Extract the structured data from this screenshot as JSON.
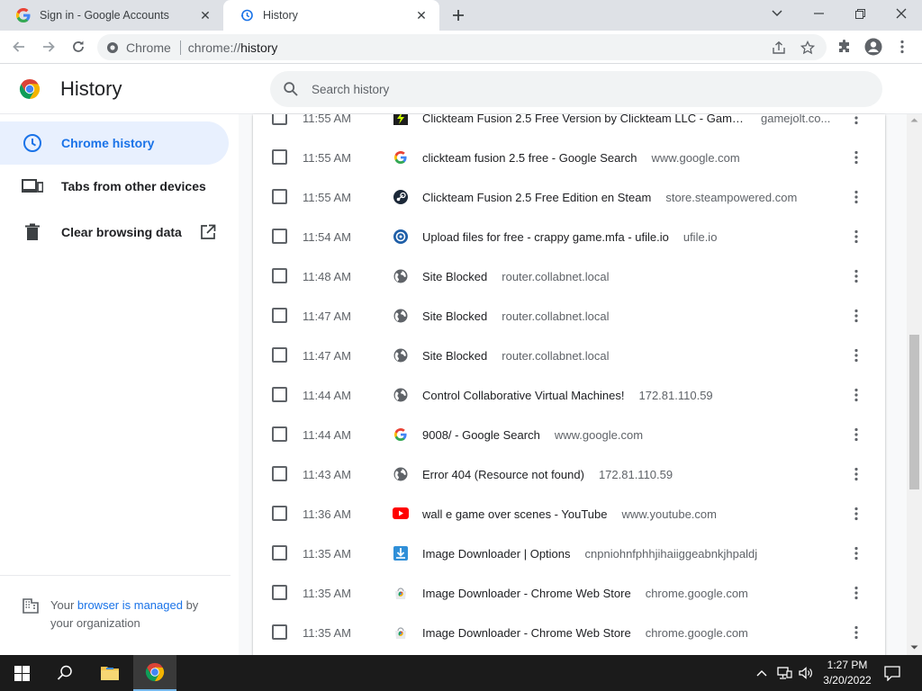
{
  "tabs": [
    {
      "title": "Sign in - Google Accounts",
      "active": false
    },
    {
      "title": "History",
      "active": true
    }
  ],
  "omnibox": {
    "site_name": "Chrome",
    "url_scheme": "chrome://",
    "url_path": "history"
  },
  "page": {
    "title": "History",
    "search_placeholder": "Search history"
  },
  "sidebar": {
    "items": [
      {
        "label": "Chrome history",
        "active": true
      },
      {
        "label": "Tabs from other devices",
        "active": false
      },
      {
        "label": "Clear browsing data",
        "active": false
      }
    ],
    "managed": {
      "prefix": "Your ",
      "link": "browser is managed",
      "suffix": " by your organization"
    }
  },
  "history": [
    {
      "time": "11:55 AM",
      "title": "Clickteam Fusion 2.5 Free Version by Clickteam LLC - Game ...",
      "domain": "gamejolt.co...",
      "favicon": "gamejolt-icon"
    },
    {
      "time": "11:55 AM",
      "title": "clickteam fusion 2.5 free - Google Search",
      "domain": "www.google.com",
      "favicon": "google-icon"
    },
    {
      "time": "11:55 AM",
      "title": "Clickteam Fusion 2.5 Free Edition en Steam",
      "domain": "store.steampowered.com",
      "favicon": "steam-icon"
    },
    {
      "time": "11:54 AM",
      "title": "Upload files for free - crappy game.mfa - ufile.io",
      "domain": "ufile.io",
      "favicon": "ufile-icon"
    },
    {
      "time": "11:48 AM",
      "title": "Site Blocked",
      "domain": "router.collabnet.local",
      "favicon": "globe-icon"
    },
    {
      "time": "11:47 AM",
      "title": "Site Blocked",
      "domain": "router.collabnet.local",
      "favicon": "globe-icon"
    },
    {
      "time": "11:47 AM",
      "title": "Site Blocked",
      "domain": "router.collabnet.local",
      "favicon": "globe-icon"
    },
    {
      "time": "11:44 AM",
      "title": "Control Collaborative Virtual Machines!",
      "domain": "172.81.110.59",
      "favicon": "globe-icon"
    },
    {
      "time": "11:44 AM",
      "title": "9008/ - Google Search",
      "domain": "www.google.com",
      "favicon": "google-icon"
    },
    {
      "time": "11:43 AM",
      "title": "Error 404 (Resource not found)",
      "domain": "172.81.110.59",
      "favicon": "globe-icon"
    },
    {
      "time": "11:36 AM",
      "title": "wall e game over scenes - YouTube",
      "domain": "www.youtube.com",
      "favicon": "youtube-icon"
    },
    {
      "time": "11:35 AM",
      "title": "Image Downloader | Options",
      "domain": "cnpniohnfphhjihaiiggeabnkjhpaldj",
      "favicon": "download-icon"
    },
    {
      "time": "11:35 AM",
      "title": "Image Downloader - Chrome Web Store",
      "domain": "chrome.google.com",
      "favicon": "webstore-icon"
    },
    {
      "time": "11:35 AM",
      "title": "Image Downloader - Chrome Web Store",
      "domain": "chrome.google.com",
      "favicon": "webstore-icon"
    }
  ],
  "taskbar": {
    "time": "1:27 PM",
    "date": "3/20/2022"
  },
  "colors": {
    "accent": "#1a73e8",
    "active_bg": "#e8f0fe",
    "taskbar": "#1b1b1b"
  }
}
